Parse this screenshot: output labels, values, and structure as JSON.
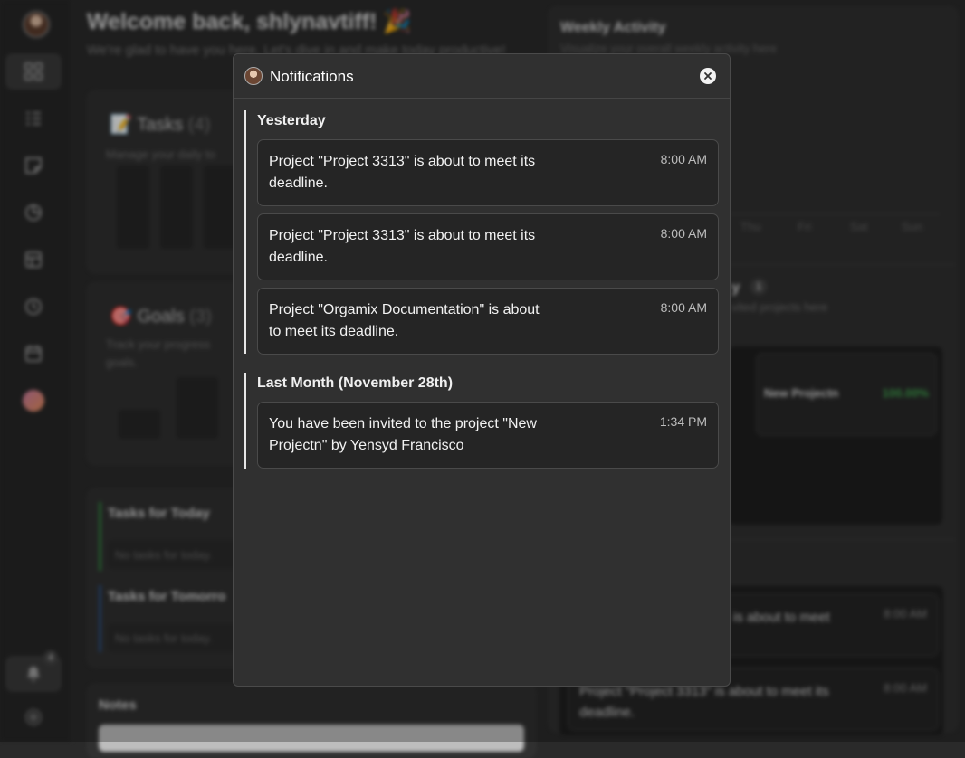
{
  "background": {
    "welcome_title": "Welcome back, shlynavtiff! 🎉",
    "welcome_sub": "We're glad to have you here. Let's dive in and make today productive!",
    "tasks_icon": "📝",
    "tasks_title": "Tasks",
    "tasks_count": "(4)",
    "tasks_sub": "Manage your daily to",
    "goals_icon": "🎯",
    "goals_title": "Goals",
    "goals_count": "(3)",
    "goals_sub": "Track your progress",
    "goals_sub2": "goals.",
    "tasks_today": "Tasks for Today",
    "tasks_tomorrow": "Tasks for Tomorro",
    "no_tasks": "No tasks for today.",
    "notes": "Notes",
    "weekly_title": "Weekly Activity",
    "weekly_sub": "Visualize your overall weekly activity here",
    "days": [
      "Thu",
      "Fri",
      "Sat",
      "Sun"
    ],
    "projects_title_fragment": "y",
    "projects_count": "1",
    "projects_sub_fragment": "vited projects here",
    "project_name": "New Projectn",
    "project_progress": "100.00%",
    "bg_notif_1_msg": "is about to meet",
    "bg_notif_1_time": "8:00 AM",
    "bg_notif_2_msg": "Project \"Project 3313\" is about to meet its deadline.",
    "bg_notif_2_time": "8:00 AM",
    "bell_badge": "4"
  },
  "modal": {
    "title": "Notifications",
    "groups": [
      {
        "label": "Yesterday",
        "items": [
          {
            "message": "Project \"Project 3313\" is about to meet its deadline.",
            "time": "8:00 AM"
          },
          {
            "message": "Project \"Project 3313\" is about to meet its deadline.",
            "time": "8:00 AM"
          },
          {
            "message": "Project \"Orgamix Documentation\" is about to meet its deadline.",
            "time": "8:00 AM"
          }
        ]
      },
      {
        "label": "Last Month (November 28th)",
        "items": [
          {
            "message": "You have been invited to the project \"New Projectn\" by Yensyd Francisco",
            "time": "1:34 PM"
          }
        ]
      }
    ]
  },
  "colors": {
    "background": "#2a2a2a",
    "modal": "#303030",
    "card": "#252525",
    "accent_green": "#3fa34d"
  },
  "icons": [
    "avatar-icon",
    "dashboard-icon",
    "tasks-icon",
    "notes-icon",
    "chart-icon",
    "projects-icon",
    "clock-icon",
    "calendar-icon",
    "profile-icon",
    "bell-icon",
    "settings-icon",
    "close-icon"
  ]
}
